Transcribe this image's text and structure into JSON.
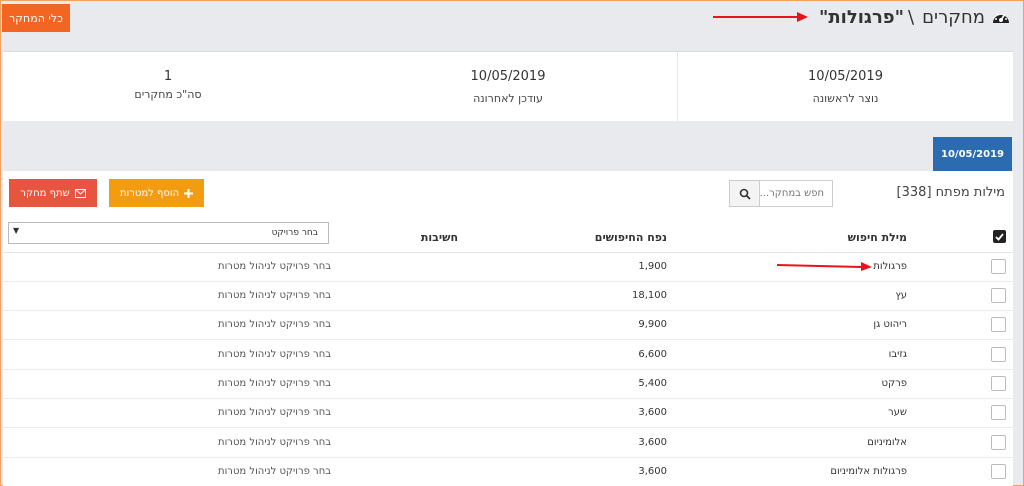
{
  "header": {
    "tools_button": "כלי המחקר",
    "crumb_parent": "מחקרים",
    "separator": "\\",
    "current": "\"פרגולות\""
  },
  "stats": [
    {
      "value": "10/05/2019",
      "label": "נוצר לראשונה"
    },
    {
      "value": "10/05/2019",
      "label": "עודכן לאחרונה"
    },
    {
      "value": "1",
      "label": "סה\"כ מחקרים"
    }
  ],
  "date_tab": "10/05/2019",
  "keywords": {
    "title": "מילות מפתח [338]",
    "search_placeholder": "חפש במחקר...",
    "add_button": "הוסף למטרות",
    "share_button": "שתף מחקר"
  },
  "table": {
    "headers": {
      "keyword": "מילת חיפוש",
      "volume": "נפח החיפושים",
      "importance": "חשיבות",
      "select_project": "בחר פרויקט"
    },
    "rows": [
      {
        "keyword": "פרגולות",
        "volume": "1,900",
        "project": "בחר פרויקט לניהול מטרות"
      },
      {
        "keyword": "עץ",
        "volume": "18,100",
        "project": "בחר פרויקט לניהול מטרות"
      },
      {
        "keyword": "ריהוט גן",
        "volume": "9,900",
        "project": "בחר פרויקט לניהול מטרות"
      },
      {
        "keyword": "גזיבו",
        "volume": "6,600",
        "project": "בחר פרויקט לניהול מטרות"
      },
      {
        "keyword": "פרקט",
        "volume": "5,400",
        "project": "בחר פרויקט לניהול מטרות"
      },
      {
        "keyword": "שער",
        "volume": "3,600",
        "project": "בחר פרויקט לניהול מטרות"
      },
      {
        "keyword": "אלומיניום",
        "volume": "3,600",
        "project": "בחר פרויקט לניהול מטרות"
      },
      {
        "keyword": "פרגולות אלומיניום",
        "volume": "3,600",
        "project": "בחר פרויקט לניהול מטרות"
      }
    ]
  },
  "colors": {
    "accent_orange": "#f26522",
    "button_add": "#f39c12",
    "button_share": "#e8553e",
    "date_tab_blue": "#2b6cb0",
    "annotation_red": "#e8141c"
  }
}
